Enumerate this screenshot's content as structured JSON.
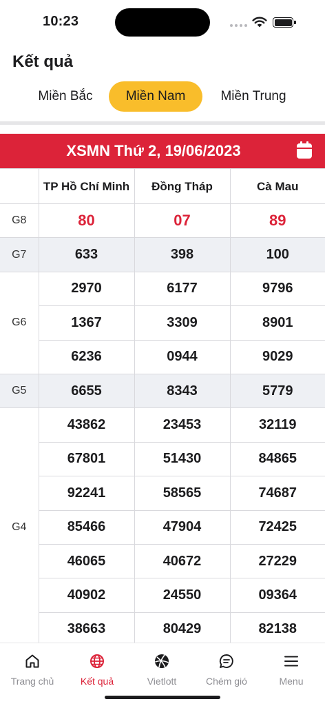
{
  "status_bar": {
    "time": "10:23"
  },
  "header": {
    "title": "Kết quả",
    "tabs": [
      {
        "label": "Miền Bắc",
        "active": false
      },
      {
        "label": "Miền Nam",
        "active": true
      },
      {
        "label": "Miền Trung",
        "active": false
      }
    ]
  },
  "banner": {
    "title": "XSMN Thứ 2, 19/06/2023"
  },
  "table": {
    "columns": [
      "TP Hồ Chí Minh",
      "Đồng Tháp",
      "Cà Mau"
    ],
    "rows": [
      {
        "prize": "G8",
        "values": [
          "80",
          "07",
          "89"
        ]
      },
      {
        "prize": "G7",
        "values": [
          "633",
          "398",
          "100"
        ]
      },
      {
        "prize": "G6",
        "values": [
          "2970",
          "6177",
          "9796"
        ]
      },
      {
        "prize": "",
        "values": [
          "1367",
          "3309",
          "8901"
        ]
      },
      {
        "prize": "",
        "values": [
          "6236",
          "0944",
          "9029"
        ]
      },
      {
        "prize": "G5",
        "values": [
          "6655",
          "8343",
          "5779"
        ]
      },
      {
        "prize": "G4",
        "values": [
          "43862",
          "23453",
          "32119"
        ]
      },
      {
        "prize": "",
        "values": [
          "67801",
          "51430",
          "84865"
        ]
      },
      {
        "prize": "",
        "values": [
          "92241",
          "58565",
          "74687"
        ]
      },
      {
        "prize": "",
        "values": [
          "85466",
          "47904",
          "72425"
        ]
      },
      {
        "prize": "",
        "values": [
          "46065",
          "40672",
          "27229"
        ]
      },
      {
        "prize": "",
        "values": [
          "40902",
          "24550",
          "09364"
        ]
      },
      {
        "prize": "",
        "values": [
          "38663",
          "80429",
          "82138"
        ]
      }
    ]
  },
  "bottom_nav": {
    "items": [
      {
        "label": "Trang chủ",
        "icon": "home-icon",
        "active": false
      },
      {
        "label": "Kết quả",
        "icon": "globe-icon",
        "active": true
      },
      {
        "label": "Vietlott",
        "icon": "ball-icon",
        "active": false
      },
      {
        "label": "Chém gió",
        "icon": "chat-icon",
        "active": false
      },
      {
        "label": "Menu",
        "icon": "menu-icon",
        "active": false
      }
    ]
  },
  "colors": {
    "accent_red": "#dc2339",
    "tab_yellow": "#f9bd2b",
    "nav_gray": "#8e8e93"
  }
}
